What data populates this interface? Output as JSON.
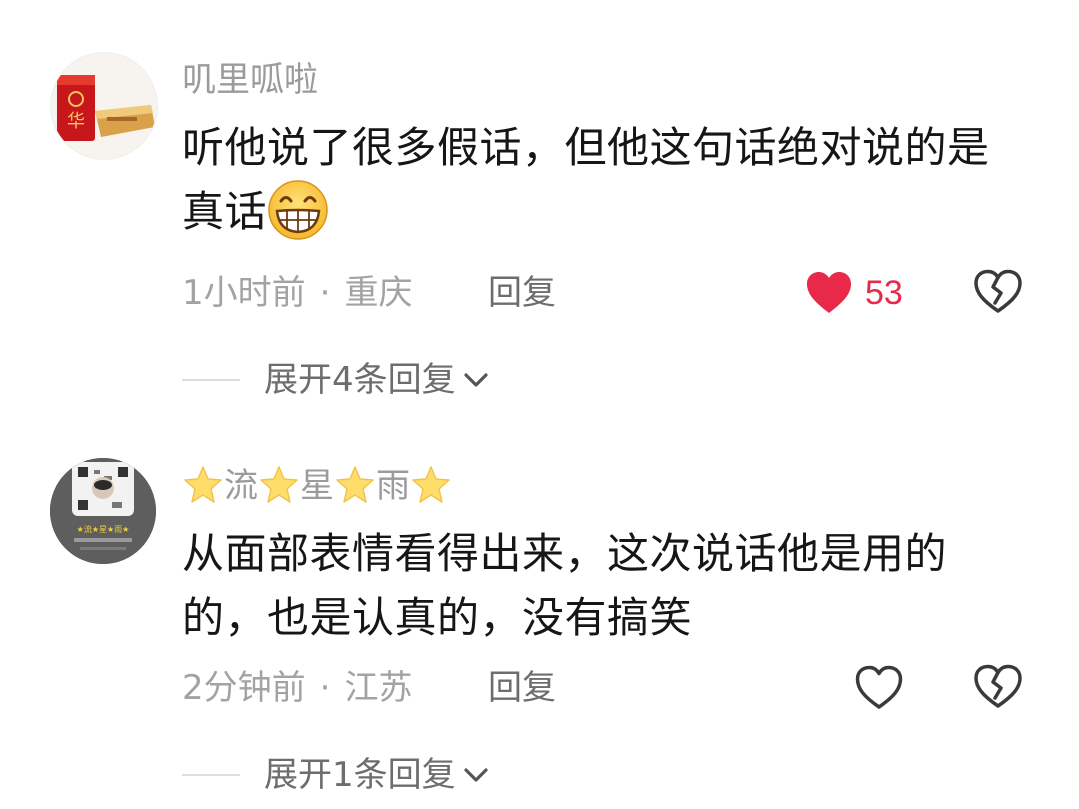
{
  "comments": [
    {
      "username": "叽里呱啦",
      "text": "听他说了很多假话，但他这句话绝对说的是真话",
      "emoji": "grinning-face",
      "time": "1小时前",
      "dot": "·",
      "location": "重庆",
      "reply_label": "回复",
      "likes": "53",
      "liked": true,
      "expand_label": "展开4条回复"
    },
    {
      "username_parts": [
        "流",
        "星",
        "雨"
      ],
      "username_decor": "star",
      "text": "从面部表情看得出来，这次说话他是用的的，也是认真的，没有搞笑",
      "time": "2分钟前",
      "dot": "·",
      "location": "江苏",
      "reply_label": "回复",
      "liked": false,
      "expand_label": "展开1条回复"
    }
  ],
  "colors": {
    "like_active": "#e8294a",
    "muted_text": "#a3a3a3",
    "body_text": "#161616"
  }
}
